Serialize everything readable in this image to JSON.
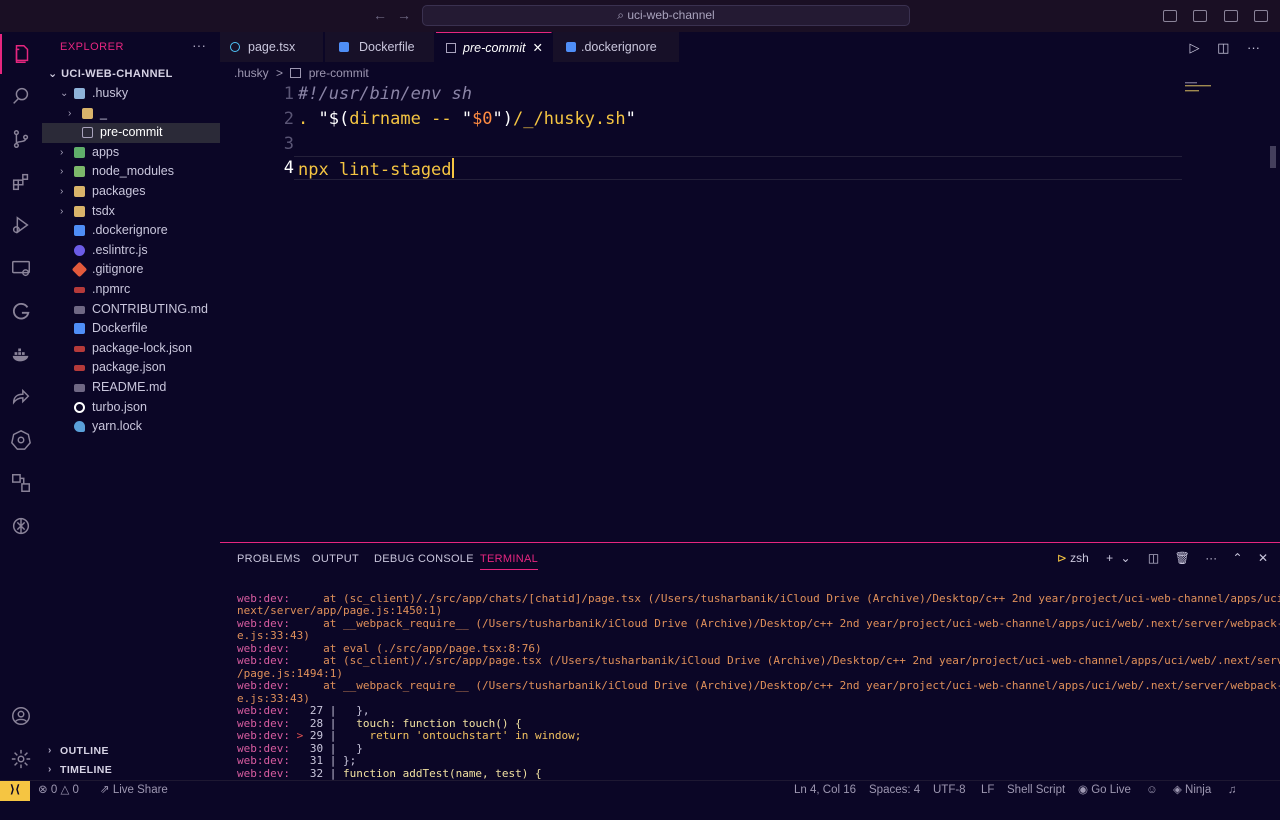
{
  "titlebar": {
    "back": "←",
    "forward": "→",
    "search_text": "uci-web-channel"
  },
  "sidebar": {
    "title": "EXPLORER",
    "more": "···",
    "root": "UCI-WEB-CHANNEL",
    "items": [
      {
        "label": ".husky"
      },
      {
        "label": "_"
      },
      {
        "label": "pre-commit"
      },
      {
        "label": "apps"
      },
      {
        "label": "node_modules"
      },
      {
        "label": "packages"
      },
      {
        "label": "tsdx"
      },
      {
        "label": ".dockerignore"
      },
      {
        "label": ".eslintrc.js"
      },
      {
        "label": ".gitignore"
      },
      {
        "label": ".npmrc"
      },
      {
        "label": "CONTRIBUTING.md"
      },
      {
        "label": "Dockerfile"
      },
      {
        "label": "package-lock.json"
      },
      {
        "label": "package.json"
      },
      {
        "label": "README.md"
      },
      {
        "label": "turbo.json"
      },
      {
        "label": "yarn.lock"
      }
    ],
    "outline": "OUTLINE",
    "timeline": "TIMELINE"
  },
  "tabs": [
    {
      "label": "page.tsx"
    },
    {
      "label": "Dockerfile"
    },
    {
      "label": "pre-commit",
      "close": "✕"
    },
    {
      "label": ".dockerignore"
    }
  ],
  "breadcrumb": {
    "folder": ".husky",
    "sep": ">",
    "file": "pre-commit"
  },
  "editor": {
    "lines": [
      {
        "num": "1"
      },
      {
        "num": "2"
      },
      {
        "num": "3"
      },
      {
        "num": "4"
      }
    ],
    "line1": "#!/usr/bin/env sh",
    "line2": {
      "dot": ". ",
      "q1": "\"",
      "d1": "$(",
      "cmd": "dirname -- ",
      "q2": "\"",
      "var": "$0",
      "q3": "\"",
      "d2": ")",
      "path": "/_/husky.sh",
      "q4": "\""
    },
    "line4": "npx lint-staged"
  },
  "panel": {
    "tabs": [
      "PROBLEMS",
      "OUTPUT",
      "DEBUG CONSOLE",
      "TERMINAL"
    ],
    "shell": "zsh",
    "terminal": [
      {
        "pre": "web:dev:",
        "text": "     at (sc_client)/./src/app/chats/[chatid]/page.tsx (/Users/tusharbanik/iCloud Drive (Archive)/Desktop/c++ 2nd year/project/uci-web-channel/apps/uci/web/."
      },
      {
        "pre": "",
        "text": "next/server/app/page.js:1450:1)"
      },
      {
        "pre": "web:dev:",
        "text": "     at __webpack_require__ (/Users/tusharbanik/iCloud Drive (Archive)/Desktop/c++ 2nd year/project/uci-web-channel/apps/uci/web/.next/server/webpack-runtim"
      },
      {
        "pre": "",
        "text": "e.js:33:43)"
      },
      {
        "pre": "web:dev:",
        "text": "     at eval (./src/app/page.tsx:8:76)"
      },
      {
        "pre": "web:dev:",
        "text": "     at (sc_client)/./src/app/page.tsx (/Users/tusharbanik/iCloud Drive (Archive)/Desktop/c++ 2nd year/project/uci-web-channel/apps/uci/web/.next/server/app"
      },
      {
        "pre": "",
        "text": "/page.js:1494:1)"
      },
      {
        "pre": "web:dev:",
        "text": "     at __webpack_require__ (/Users/tusharbanik/iCloud Drive (Archive)/Desktop/c++ 2nd year/project/uci-web-channel/apps/uci/web/.next/server/webpack-runtim"
      },
      {
        "pre": "",
        "text": "e.js:33:43)"
      }
    ],
    "code_lines": [
      {
        "pre": "web:dev:",
        "mark": "  ",
        "num": " 27",
        "sep": " |  ",
        "code": " },"
      },
      {
        "pre": "web:dev:",
        "mark": "  ",
        "num": " 28",
        "sep": " |  ",
        "code": " touch: function touch() {"
      },
      {
        "pre": "web:dev:",
        "mark": " >",
        "num": " 29",
        "sep": " |  ",
        "code": "   return 'ontouchstart' in window;"
      },
      {
        "pre": "web:dev:",
        "mark": "  ",
        "num": " 30",
        "sep": " |  ",
        "code": " }"
      },
      {
        "pre": "web:dev:",
        "mark": "  ",
        "num": " 31",
        "sep": " | ",
        "code": "};"
      },
      {
        "pre": "web:dev:",
        "mark": "  ",
        "num": " 32",
        "sep": " | ",
        "code": "function addTest(name, test) {"
      }
    ]
  },
  "status": {
    "errors": "0",
    "warnings": "0",
    "live_share": "Live Share",
    "position": "Ln 4, Col 16",
    "spaces": "Spaces: 4",
    "encoding": "UTF-8",
    "eol": "LF",
    "language": "Shell Script",
    "go_live": "Go Live",
    "ninja": "Ninja"
  },
  "colors": {
    "accent": "#e6267f",
    "background": "#0b0626",
    "cursor": "#f5c542"
  }
}
